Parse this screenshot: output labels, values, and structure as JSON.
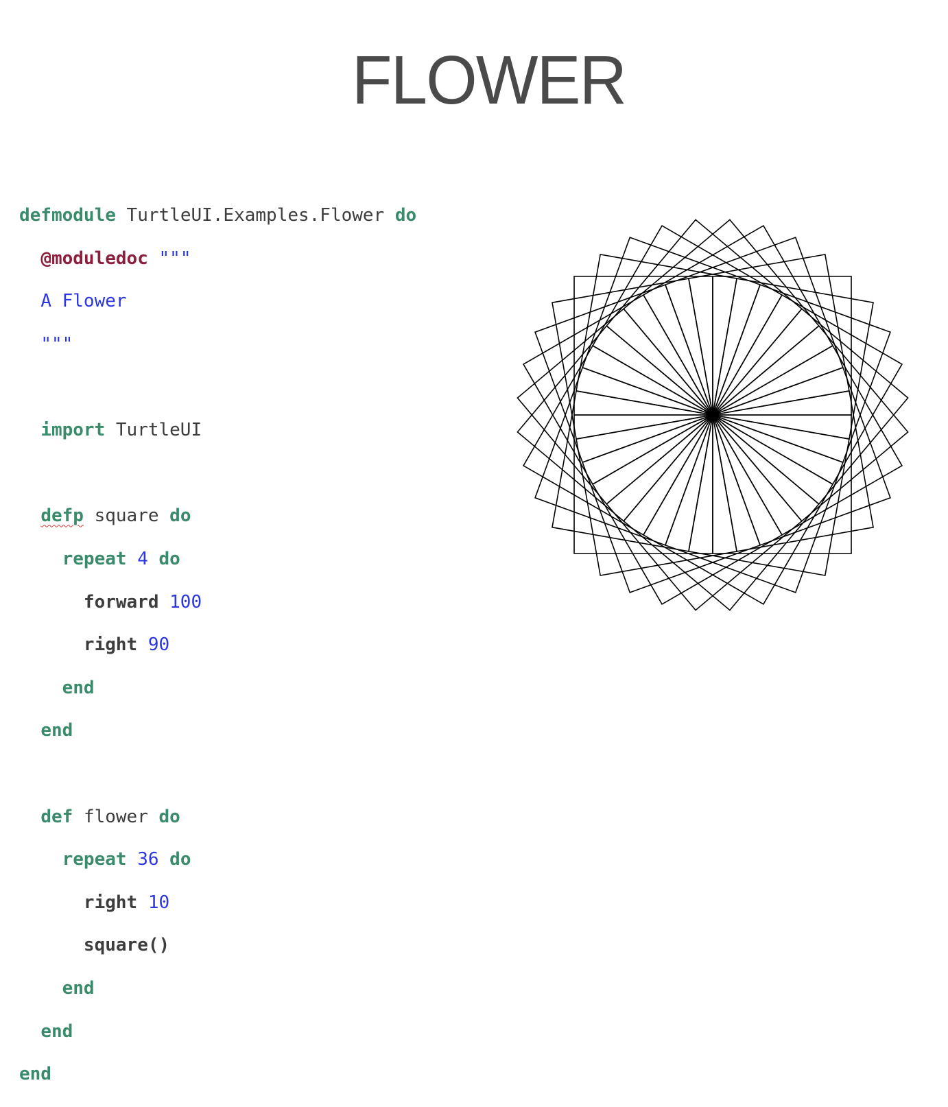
{
  "slide": {
    "title": "FLOWER"
  },
  "code": {
    "module_kw": "defmodule",
    "module_name": "TurtleUI.Examples.Flower",
    "do_1": "do",
    "moduledoc_attr": "@moduledoc",
    "doc_open": "\"\"\"",
    "doc_text": "A Flower",
    "doc_close": "\"\"\"",
    "import_kw": "import",
    "import_name": "TurtleUI",
    "defp_kw": "defp",
    "square_name": "square",
    "do_2": "do",
    "repeat_kw_1": "repeat",
    "repeat_count_1": "4",
    "do_3": "do",
    "forward_fn": "forward",
    "forward_arg": "100",
    "right_fn_1": "right",
    "right_arg_1": "90",
    "end_1": "end",
    "end_2": "end",
    "def_kw": "def",
    "flower_name": "flower",
    "do_4": "do",
    "repeat_kw_2": "repeat",
    "repeat_count_2": "36",
    "do_5": "do",
    "right_fn_2": "right",
    "right_arg_2": "10",
    "square_call": "square()",
    "end_3": "end",
    "end_4": "end",
    "end_5": "end"
  },
  "drawing": {
    "squares": 36,
    "turn_degrees": 10,
    "side": 100,
    "stroke_color": "#000000"
  }
}
